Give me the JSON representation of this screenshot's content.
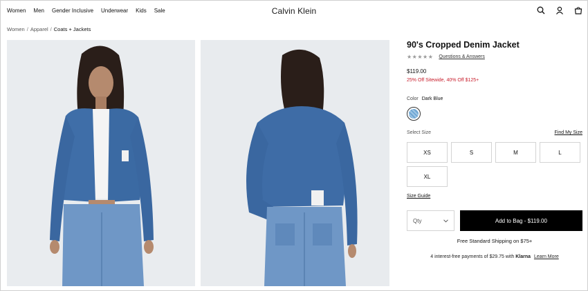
{
  "header": {
    "nav": [
      "Women",
      "Men",
      "Gender Inclusive",
      "Underwear",
      "Kids",
      "Sale"
    ],
    "logo": "Calvin Klein",
    "icons": [
      "search-icon",
      "account-icon",
      "bag-icon"
    ]
  },
  "breadcrumb": {
    "items": [
      "Women",
      "Apparel"
    ],
    "current": "Coats + Jackets",
    "separator": "/"
  },
  "product": {
    "title": "90's Cropped Denim Jacket",
    "stars": "★★★★★",
    "qa_link": "Questions & Answers",
    "price": "$119.00",
    "promo": "25% Off Sitewide, 40% Off $125+",
    "color_label": "Color",
    "color_value": "Dark Blue",
    "size_label": "Select Size",
    "find_size": "Find My Size",
    "sizes": [
      "XS",
      "S",
      "M",
      "L",
      "XL"
    ],
    "size_guide": "Size Guide",
    "qty_placeholder": "Qty",
    "add_to_bag": "Add to Bag - $119.00",
    "shipping": "Free Standard Shipping on $75+",
    "klarna_text": "4 interest-free payments of $29.75 with",
    "klarna_brand": "Klarna",
    "klarna_link": "Learn More"
  },
  "colors": {
    "promo": "#c81e2c",
    "button": "#000000",
    "denim": "#3f6ea8"
  }
}
